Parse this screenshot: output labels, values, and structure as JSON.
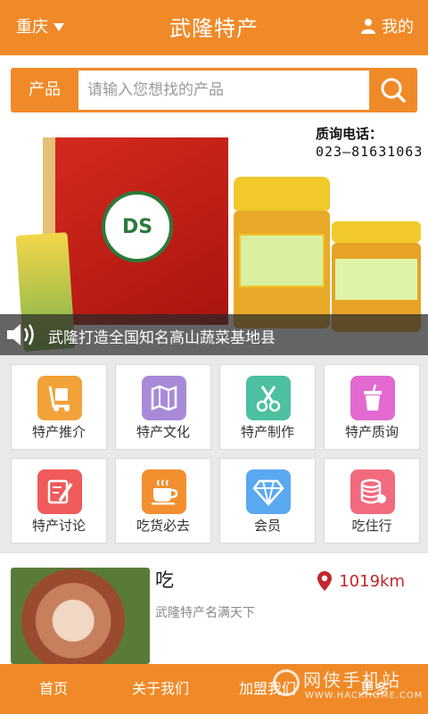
{
  "header": {
    "city": "重庆",
    "title": "武隆特产",
    "user_label": "我的"
  },
  "search": {
    "category_label": "产品",
    "placeholder": "请输入您想找的产品"
  },
  "banner": {
    "contact_label": "质询电话：",
    "contact_phone": "023—81631063",
    "seal_text": "DS",
    "caption": "武隆打造全国知名高山蔬菜基地县"
  },
  "grid": [
    {
      "label": "特产推介",
      "icon": "cart-dolly-icon",
      "color": "#f3a23a"
    },
    {
      "label": "特产文化",
      "icon": "map-icon",
      "color": "#a88ad8"
    },
    {
      "label": "特产制作",
      "icon": "scissors-icon",
      "color": "#4cc0a0"
    },
    {
      "label": "特产质询",
      "icon": "cup-icon",
      "color": "#e26ad0"
    },
    {
      "label": "特产讨论",
      "icon": "note-pen-icon",
      "color": "#f05a5a"
    },
    {
      "label": "吃货必去",
      "icon": "coffee-cup-icon",
      "color": "#f2902f"
    },
    {
      "label": "会员",
      "icon": "diamond-icon",
      "color": "#5aa8f0"
    },
    {
      "label": "吃住行",
      "icon": "database-icon",
      "color": "#f26a7e"
    }
  ],
  "list": {
    "name": "吃",
    "desc": "武隆特产名满天下",
    "distance": "1019km"
  },
  "tabbar": [
    "首页",
    "关于我们",
    "加盟我们",
    "更多"
  ],
  "watermark": {
    "cn": "网侠手机站",
    "en": "WWW.HACKHOME.COM"
  },
  "colors": {
    "brand": "#f08a28",
    "location_pin": "#c1272d"
  }
}
